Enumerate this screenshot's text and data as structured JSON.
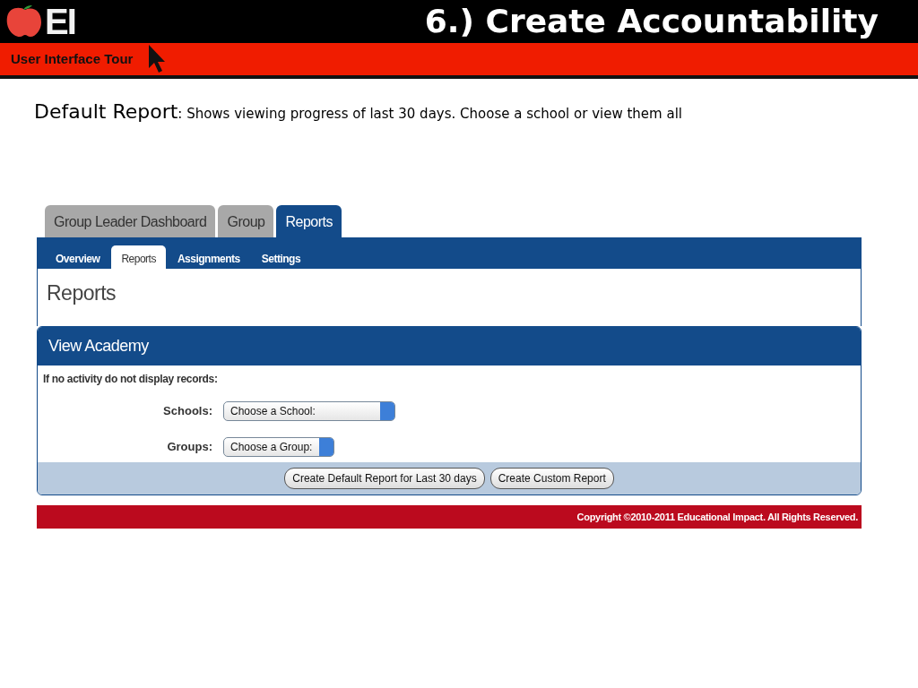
{
  "slide": {
    "logo_text": "EI",
    "title": "6.)  Create Accountability",
    "banner": "User Interface Tour"
  },
  "heading": {
    "term": "Default Report",
    "text": ":  Shows viewing progress of last 30 days.  Choose a school or view them all"
  },
  "app": {
    "tabs": [
      {
        "label": "Group Leader Dashboard",
        "selected": false
      },
      {
        "label": "Group",
        "selected": false
      },
      {
        "label": "Reports",
        "selected": true
      }
    ],
    "subtabs": [
      {
        "label": "Overview",
        "selected": false
      },
      {
        "label": "Reports",
        "selected": true
      },
      {
        "label": "Assignments",
        "selected": false
      },
      {
        "label": "Settings",
        "selected": false
      }
    ],
    "page_title": "Reports",
    "section_title": "View Academy",
    "note": "If no activity do not display records:",
    "fields": [
      {
        "label": "Schools:",
        "value": "Choose a School:"
      },
      {
        "label": "Groups:",
        "value": "Choose a Group:"
      }
    ],
    "buttons": [
      "Create Default Report for Last 30 days",
      "Create Custom Report"
    ],
    "footer": "Copyright ©2010-2011 Educational Impact. All Rights Reserved."
  }
}
